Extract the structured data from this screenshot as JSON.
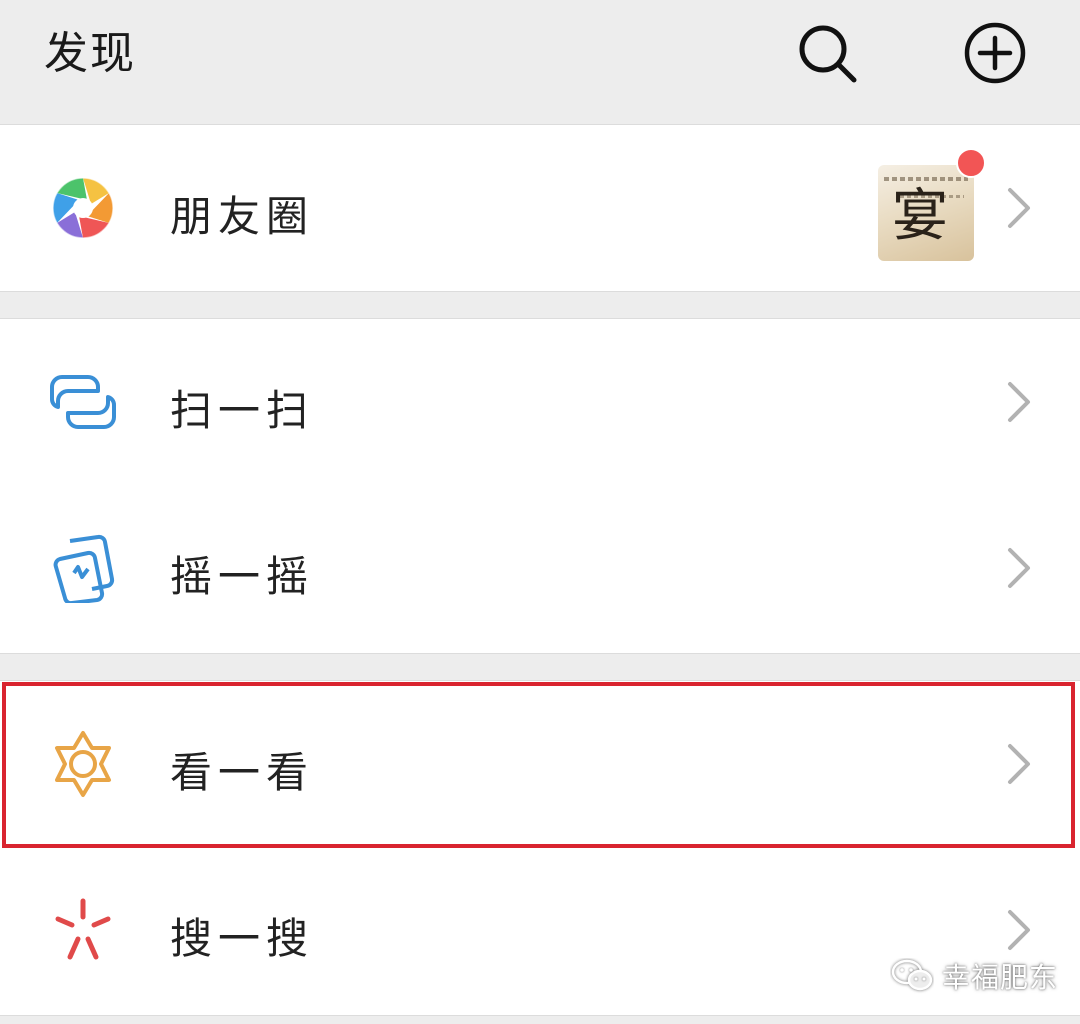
{
  "header": {
    "title": "发现",
    "search_icon": "search-icon",
    "add_icon": "plus-circle-icon"
  },
  "moments": {
    "label": "朋友圈",
    "icon": "moments-aperture-icon",
    "has_new_badge": true
  },
  "scan": {
    "label": "扫一扫",
    "icon": "scan-icon",
    "color": "#3a8fd6"
  },
  "shake": {
    "label": "摇一摇",
    "icon": "shake-phone-icon",
    "color": "#3a8fd6"
  },
  "top_stories": {
    "label": "看一看",
    "icon": "top-stories-star-icon",
    "color": "#e8a547",
    "highlighted": true
  },
  "search": {
    "label": "搜一搜",
    "icon": "search-sparkle-icon",
    "color": "#e04a4a"
  },
  "watermark": {
    "text": "幸福肥东",
    "icon": "wechat-icon"
  },
  "colors": {
    "background": "#ededed",
    "card": "#ffffff",
    "highlight_border": "#d9242f",
    "badge": "#f25555",
    "chevron": "#b2b2b2"
  }
}
